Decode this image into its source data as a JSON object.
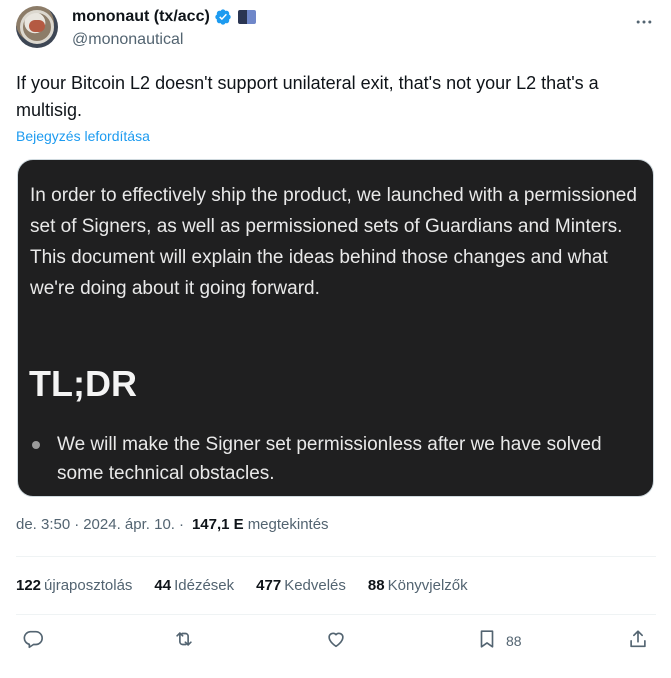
{
  "author": {
    "display_name": "mononaut (tx/acc)",
    "handle": "@mononautical"
  },
  "tweet": {
    "text": "If your Bitcoin L2 doesn't support unilateral exit, that's not your L2 that's a multisig.",
    "translate_label": "Bejegyzés lefordítása"
  },
  "media": {
    "paragraph": "In order to effectively ship the product, we launched with a permissioned set of Signers, as well as permissioned sets of Guardians and Minters. This document will explain the ideas behind those changes and what we're doing about it going forward.",
    "heading": "TL;DR",
    "bullet": "We will make the Signer set permissionless after we have solved some technical obstacles."
  },
  "meta": {
    "time": "de. 3:50",
    "separator": "·",
    "date": "2024. ápr. 10.",
    "views_count": "147,1 E",
    "views_label": "megtekintés"
  },
  "stats": {
    "reposts_count": "122",
    "reposts_label": "újraposztolás",
    "quotes_count": "44",
    "quotes_label": "Idézések",
    "likes_count": "477",
    "likes_label": "Kedvelés",
    "bookmarks_count": "88",
    "bookmarks_label": "Könyvjelzők"
  },
  "actions": {
    "bookmark_count": "88"
  },
  "icons": {
    "verified": "verified-badge-icon",
    "flag": "flag-icon",
    "more": "more-horizontal-icon",
    "reply": "reply-icon",
    "repost": "repost-icon",
    "like": "heart-icon",
    "bookmark": "bookmark-icon",
    "share": "share-icon"
  },
  "colors": {
    "accent": "#1d9bf0",
    "text": "#0f1419",
    "muted": "#536471",
    "media_bg": "#1f1f20"
  }
}
